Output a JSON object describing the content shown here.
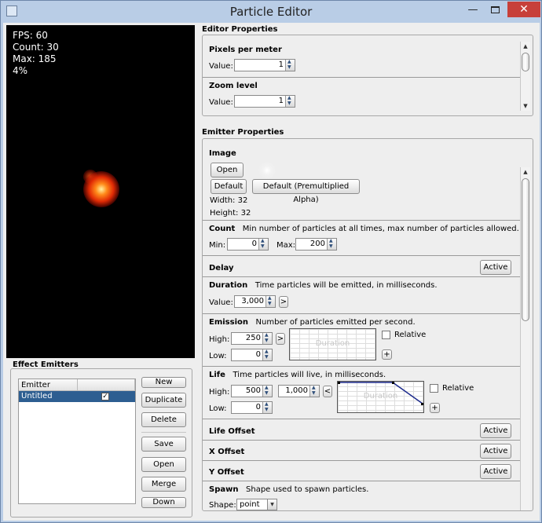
{
  "window": {
    "title": "Particle Editor",
    "minimize": "—",
    "close": "✕"
  },
  "preview": {
    "fps": "FPS: 60",
    "count": "Count: 30",
    "max": "Max: 185",
    "percent": "4%"
  },
  "effect_emitters": {
    "title": "Effect Emitters",
    "table_header": "Emitter",
    "rows": [
      {
        "name": "Untitled",
        "checked": "✓"
      }
    ],
    "buttons": {
      "new": "New",
      "duplicate": "Duplicate",
      "delete": "Delete",
      "save": "Save",
      "open": "Open",
      "merge": "Merge",
      "down": "Down"
    }
  },
  "editor_properties": {
    "title": "Editor Properties",
    "pixels_per_meter": {
      "title": "Pixels per meter",
      "label": "Value:",
      "value": "1"
    },
    "zoom_level": {
      "title": "Zoom level",
      "label": "Value:",
      "value": "1"
    }
  },
  "emitter_properties": {
    "title": "Emitter Properties",
    "image": {
      "title": "Image",
      "open": "Open",
      "default": "Default",
      "default_pma": "Default (Premultiplied Alpha)",
      "width": "Width: 32",
      "height": "Height: 32"
    },
    "count": {
      "title": "Count",
      "desc": "Min number of particles at all times, max number of particles allowed.",
      "min_label": "Min:",
      "min": "0",
      "max_label": "Max:",
      "max": "200"
    },
    "delay": {
      "title": "Delay",
      "active": "Active"
    },
    "duration": {
      "title": "Duration",
      "desc": "Time particles will be emitted, in milliseconds.",
      "label": "Value:",
      "value": "3,000",
      "expand": ">"
    },
    "emission": {
      "title": "Emission",
      "desc": "Number of particles emitted per second.",
      "high_label": "High:",
      "high": "250",
      "low_label": "Low:",
      "low": "0",
      "expand": ">",
      "graph_label": "Duration",
      "relative": "Relative",
      "add": "+"
    },
    "life": {
      "title": "Life",
      "desc": "Time particles will live, in milliseconds.",
      "high_label": "High:",
      "high": "500",
      "high2": "1,000",
      "low_label": "Low:",
      "low": "0",
      "collapse": "<",
      "expand": ">",
      "graph_label": "Duration",
      "relative": "Relative",
      "add": "+"
    },
    "life_offset": {
      "title": "Life Offset",
      "active": "Active"
    },
    "x_offset": {
      "title": "X Offset",
      "active": "Active"
    },
    "y_offset": {
      "title": "Y Offset",
      "active": "Active"
    },
    "spawn": {
      "title": "Spawn",
      "desc": "Shape used to spawn particles.",
      "shape_label": "Shape:",
      "shape": "point"
    }
  }
}
